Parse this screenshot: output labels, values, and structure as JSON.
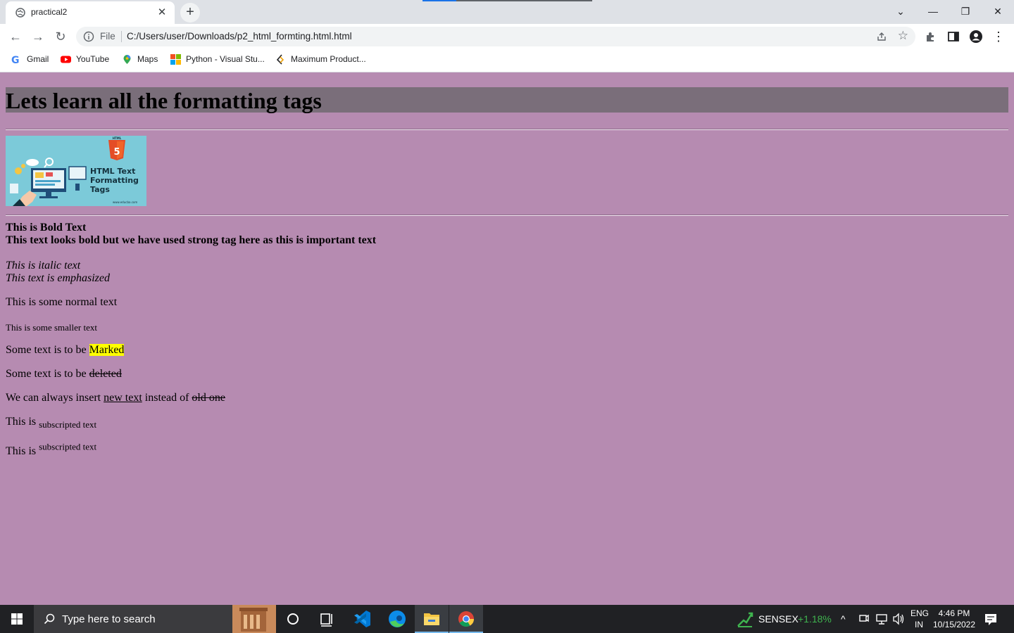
{
  "browser": {
    "tab_title": "practical2",
    "tab_close": "✕",
    "new_tab": "+",
    "scheme_label": "File",
    "url": "C:/Users/user/Downloads/p2_html_formting.html.html",
    "controls": {
      "tab_search": "⌄",
      "minimize": "—",
      "restore": "❐",
      "close": "✕"
    },
    "nav": {
      "back": "←",
      "forward": "→",
      "reload": "↻"
    },
    "bookmarks": [
      {
        "label": "Gmail",
        "icon": "gmail-icon"
      },
      {
        "label": "YouTube",
        "icon": "youtube-icon"
      },
      {
        "label": "Maps",
        "icon": "maps-icon"
      },
      {
        "label": "Python - Visual Stu...",
        "icon": "microsoft-icon"
      },
      {
        "label": "Maximum Product...",
        "icon": "code-icon"
      }
    ]
  },
  "page": {
    "background": "#b68bb1",
    "heading": "Lets learn all the formatting tags",
    "banner": {
      "line1": "HTML Text",
      "line2": "Formatting",
      "line3": "Tags",
      "footer": "www.educba.com",
      "badge": "HTML",
      "badge_num": "5"
    },
    "bold_text": "This is Bold Text",
    "strong_text": "This text looks bold but we have used strong tag here as this is important text",
    "italic_text": "This is italic text",
    "em_text": "This text is emphasized",
    "normal_text": "This is some normal text",
    "small_text": "This is some smaller text",
    "mark_prefix": "Some text is to be ",
    "mark_word": "Marked",
    "del_prefix": "Some text is to be ",
    "del_word": "deleted",
    "ins_prefix": "We can always insert ",
    "ins_word": "new text",
    "ins_middle": " instead of ",
    "ins_old": "old one",
    "sub_prefix": "This is ",
    "sub_text": "subscripted text",
    "sup_prefix": "This is ",
    "sup_text": "subscripted text"
  },
  "taskbar": {
    "search_placeholder": "Type here to search",
    "sensex_label": "SENSEX",
    "sensex_value": "+1.18%",
    "lang_top": "ENG",
    "lang_bottom": "IN",
    "time": "4:46 PM",
    "date": "10/15/2022",
    "colors": {
      "bar": "#202124",
      "sensex_positive": "#3fb34f"
    }
  }
}
